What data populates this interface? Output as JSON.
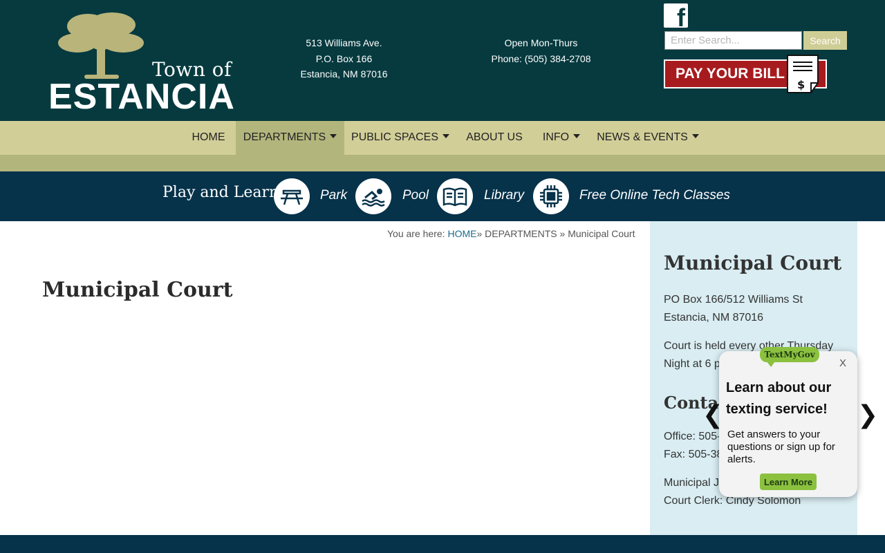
{
  "header": {
    "logo": {
      "line1": "Town of",
      "line2": "ESTANCIA"
    },
    "address": {
      "line1": "513 Williams Ave.",
      "line2": "P.O. Box 166",
      "line3": "Estancia, NM 87016"
    },
    "contact": {
      "line1": "Open Mon-Thurs",
      "line2": "Phone: (505) 384-2708"
    },
    "facebook_glyph": "f",
    "search": {
      "placeholder": "Enter Search...",
      "button_label": "Search"
    },
    "pay_bill_label": "PAY YOUR BILL"
  },
  "nav": {
    "items": [
      {
        "label": "HOME"
      },
      {
        "label": "DEPARTMENTS"
      },
      {
        "label": "PUBLIC SPACES"
      },
      {
        "label": "ABOUT US"
      },
      {
        "label": "INFO"
      },
      {
        "label": "NEWS & EVENTS"
      }
    ]
  },
  "learn_bar": {
    "title": "Play and Learn",
    "items": [
      {
        "label": "Park",
        "icon": "picnic-table-icon"
      },
      {
        "label": "Pool",
        "icon": "swimmer-icon"
      },
      {
        "label": "Library",
        "icon": "book-icon"
      },
      {
        "label": "Free Online Tech Classes",
        "icon": "microchip-icon"
      }
    ]
  },
  "breadcrumb": {
    "prefix": "You are here:",
    "home": "HOME",
    "sep1": "»",
    "departments": "DEPARTMENTS",
    "sep2": "»",
    "current": "Municipal Court"
  },
  "main": {
    "title": "Municipal Court"
  },
  "sidebar": {
    "title": "Municipal Court",
    "address_line1": "PO Box 166/512 Williams St",
    "address_line2": "Estancia, NM  87016",
    "court_line1": "Court is held every other Thursday",
    "court_line2": "Night at 6 p",
    "contact_title": "Contac",
    "office": "Office: 505-",
    "fax": "Fax: 505-38",
    "judge": "Municipal J",
    "clerk": "Court Clerk: Cindy Solomon"
  },
  "popup": {
    "badge": "TextMyGov",
    "close": "X",
    "heading": "Learn about our texting service!",
    "body": "Get answers to your questions or sign up for alerts.",
    "button": "Learn More",
    "prev": "❮",
    "next": "❯"
  },
  "colors": {
    "header_bg": "#063a3f",
    "nav_bg": "#d1ce98",
    "nav_active": "#b3b67c",
    "learn_bar_bg": "#06324a",
    "pay_bill_red": "#a71b1e",
    "sidebar_bg": "#d9edf2",
    "textmygov_green": "#8bc13f",
    "link_blue": "#1c6a8c"
  }
}
